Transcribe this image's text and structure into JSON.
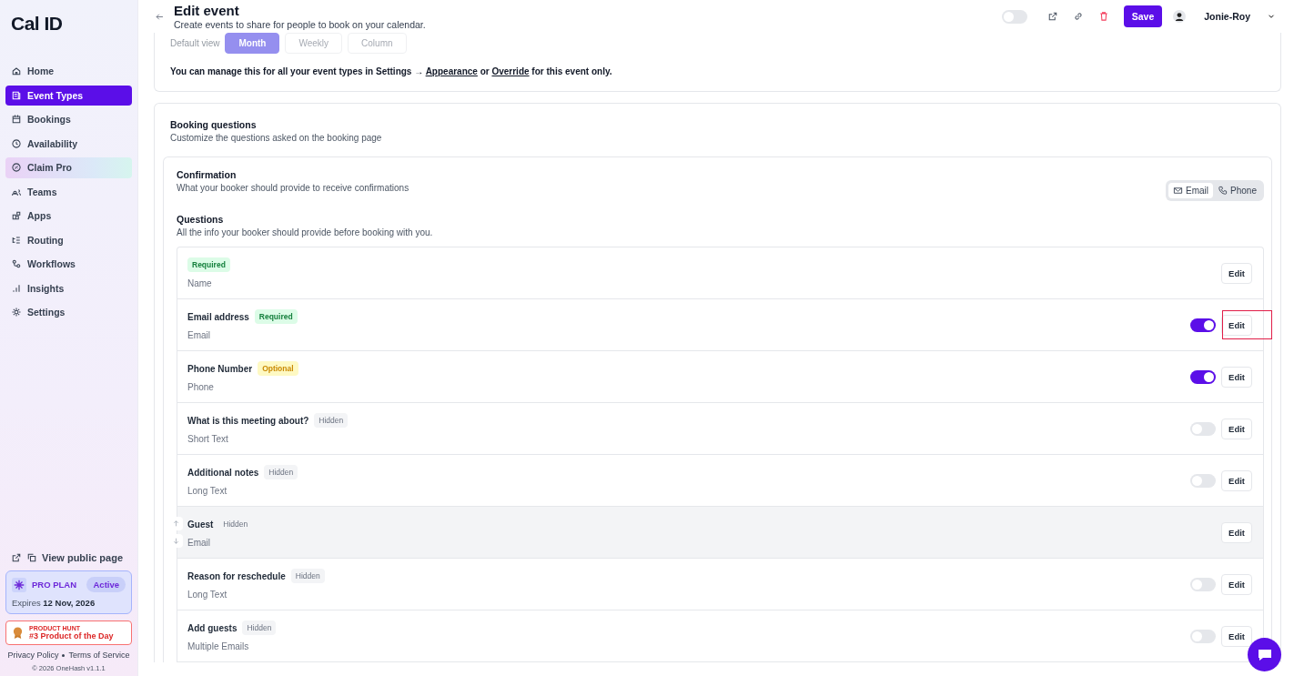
{
  "sidebar": {
    "logo": "Cal ID",
    "items": [
      {
        "label": "Home",
        "selected": false,
        "kind": "normal"
      },
      {
        "label": "Event Types",
        "selected": true,
        "kind": "normal"
      },
      {
        "label": "Bookings",
        "selected": false,
        "kind": "normal"
      },
      {
        "label": "Availability",
        "selected": false,
        "kind": "normal"
      },
      {
        "label": "Claim Pro",
        "selected": false,
        "kind": "promo"
      },
      {
        "label": "Teams",
        "selected": false,
        "kind": "normal"
      },
      {
        "label": "Apps",
        "selected": false,
        "kind": "normal"
      },
      {
        "label": "Routing",
        "selected": false,
        "kind": "normal"
      },
      {
        "label": "Workflows",
        "selected": false,
        "kind": "normal"
      },
      {
        "label": "Insights",
        "selected": false,
        "kind": "normal"
      },
      {
        "label": "Settings",
        "selected": false,
        "kind": "normal"
      }
    ],
    "public_link": "View public page",
    "plan": {
      "name": "PRO PLAN",
      "status": "Active",
      "expires_label": "Expires",
      "expires_date": "12 Nov, 2026"
    },
    "product_hunt": {
      "small": "PRODUCT HUNT",
      "title": "#3 Product of the Day"
    },
    "footer_links": [
      "Privacy Policy",
      "Terms of Service"
    ],
    "copyright": "© 2026 OneHash v1.1.1"
  },
  "header": {
    "title": "Edit event",
    "subtitle": "Create events to share for people to book on your calendar.",
    "hidden_toggle": {
      "on": false
    },
    "save": "Save",
    "user": "Jonie-Roy"
  },
  "layout_card": {
    "label": "Default view",
    "disabled": true,
    "options": [
      {
        "label": "Month",
        "selected": true
      },
      {
        "label": "Weekly",
        "selected": false
      },
      {
        "label": "Column",
        "selected": false
      }
    ],
    "note": {
      "before": "You can manage this for all your event types in Settings → ",
      "link1": "Appearance",
      "middle": " or ",
      "link2": "Override",
      "after": " for this event only."
    }
  },
  "booking_questions": {
    "title": "Booking questions",
    "subtitle": "Customize the questions asked on the booking page",
    "confirmation": {
      "title": "Confirmation",
      "subtitle": "What your booker should provide to receive confirmations",
      "options": [
        {
          "label": "Email",
          "selected": true
        },
        {
          "label": "Phone",
          "selected": false
        }
      ]
    },
    "questions_title": "Questions",
    "questions_subtitle": "All the info your booker should provide before booking with you.",
    "rows": [
      {
        "badge": {
          "text": "Required",
          "kind": "required"
        },
        "type": "Name",
        "edit": "Edit",
        "hovered": false,
        "edit_marked": false
      },
      {
        "title": "Email address",
        "badge": {
          "text": "Required",
          "kind": "required"
        },
        "type": "Email",
        "toggle": {
          "on": true
        },
        "edit": "Edit",
        "hovered": false,
        "edit_marked": true
      },
      {
        "title": "Phone Number",
        "badge": {
          "text": "Optional",
          "kind": "optional"
        },
        "type": "Phone",
        "toggle": {
          "on": true
        },
        "edit": "Edit",
        "hovered": false,
        "edit_marked": false
      },
      {
        "title": "What is this meeting about?",
        "badge": {
          "text": "Hidden",
          "kind": "hidden"
        },
        "type": "Short Text",
        "toggle": {
          "on": false
        },
        "edit": "Edit",
        "hovered": false,
        "edit_marked": false
      },
      {
        "title": "Additional notes",
        "badge": {
          "text": "Hidden",
          "kind": "hidden"
        },
        "type": "Long Text",
        "toggle": {
          "on": false
        },
        "edit": "Edit",
        "hovered": false,
        "edit_marked": false
      },
      {
        "title": "Guest",
        "badge": {
          "text": "Hidden",
          "kind": "hidden"
        },
        "type": "Email",
        "edit": "Edit",
        "hovered": true,
        "edit_marked": false
      },
      {
        "title": "Reason for reschedule",
        "badge": {
          "text": "Hidden",
          "kind": "hidden"
        },
        "type": "Long Text",
        "toggle": {
          "on": false
        },
        "edit": "Edit",
        "hovered": false,
        "edit_marked": false
      },
      {
        "title": "Add guests",
        "badge": {
          "text": "Hidden",
          "kind": "hidden"
        },
        "type": "Multiple Emails",
        "toggle": {
          "on": false
        },
        "edit": "Edit",
        "hovered": false,
        "edit_marked": false
      }
    ]
  }
}
